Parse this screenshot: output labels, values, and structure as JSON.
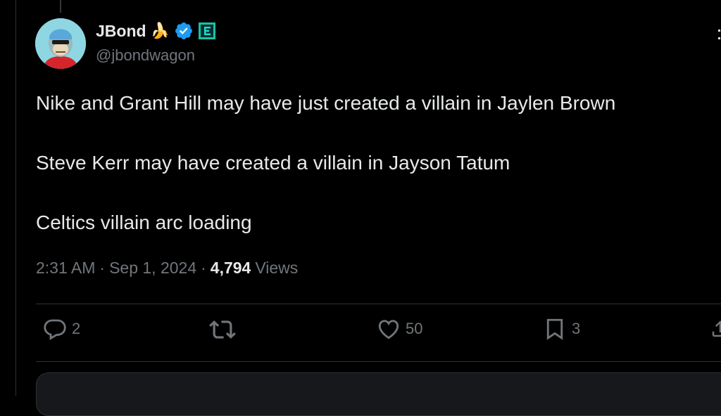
{
  "tweet": {
    "author": {
      "display_name": "JBond",
      "emoji": "🍌",
      "handle": "@jbondwagon",
      "verified_icon": "verified-badge-icon",
      "org_badge_icon": "affiliate-badge-icon"
    },
    "text_lines": [
      "Nike and Grant Hill may have just created a villain in Jaylen Brown",
      "Steve Kerr may have created a villain in Jayson Tatum",
      "Celtics villain arc loading"
    ],
    "meta": {
      "time": "2:31 AM",
      "separator": "·",
      "date": "Sep 1, 2024",
      "views_count": "4,794",
      "views_label": "Views"
    },
    "actions": {
      "reply_count": "2",
      "retweet_count": "",
      "like_count": "50",
      "bookmark_count": "3"
    }
  },
  "colors": {
    "background": "#000000",
    "text": "#e7e9ea",
    "secondary": "#71767b",
    "verified": "#1d9bf0",
    "border": "#2f3336"
  }
}
